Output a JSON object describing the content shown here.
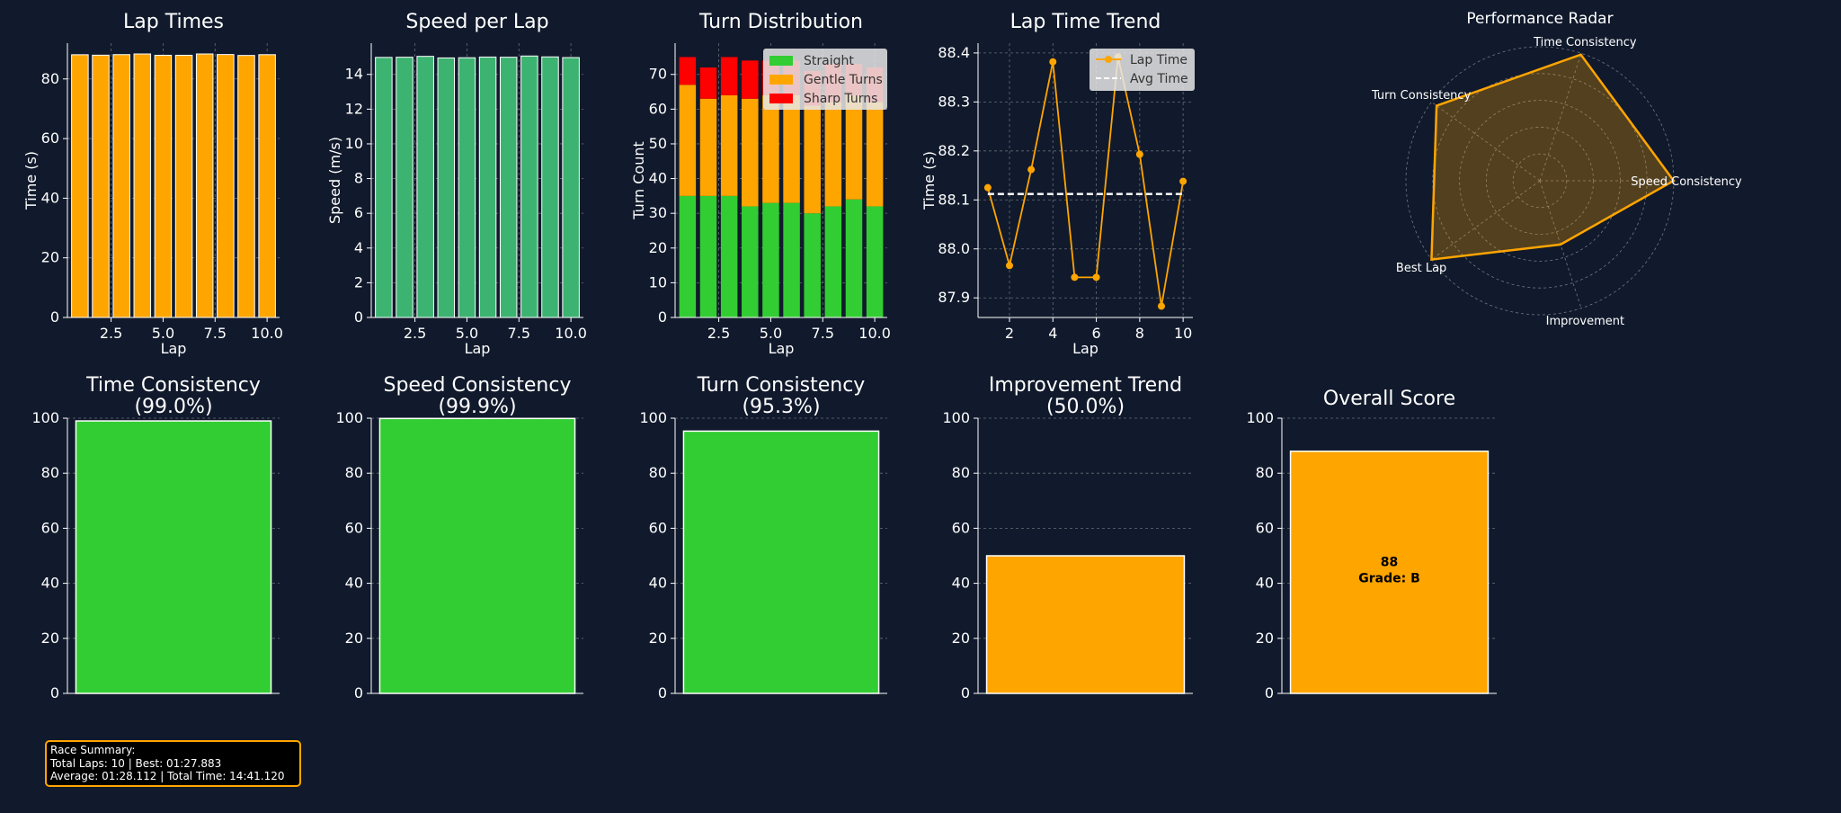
{
  "chart_data": [
    {
      "type": "bar",
      "title": "Lap Times",
      "xlabel": "Lap",
      "ylabel": "Time (s)",
      "x": [
        1,
        2,
        3,
        4,
        5,
        6,
        7,
        8,
        9,
        10
      ],
      "values": [
        88.12,
        87.97,
        88.16,
        88.38,
        87.94,
        87.94,
        88.38,
        88.19,
        87.88,
        88.14
      ],
      "xlim": [
        0.4,
        10.6
      ],
      "ylim": [
        0,
        92
      ],
      "xticks": [
        2.5,
        5.0,
        7.5,
        10.0
      ],
      "yticks": [
        0,
        20,
        40,
        60,
        80
      ],
      "grid": true,
      "colors": {
        "bar": "#ffa500",
        "edge": "#ffffff"
      }
    },
    {
      "type": "bar",
      "title": "Speed per Lap",
      "xlabel": "Lap",
      "ylabel": "Speed (m/s)",
      "x": [
        1,
        2,
        3,
        4,
        5,
        6,
        7,
        8,
        9,
        10
      ],
      "values": [
        14.98,
        14.99,
        15.04,
        14.95,
        14.96,
        15.0,
        14.99,
        15.06,
        15.01,
        14.97
      ],
      "xlim": [
        0.4,
        10.6
      ],
      "ylim": [
        0,
        15.8
      ],
      "xticks": [
        2.5,
        5.0,
        7.5,
        10.0
      ],
      "yticks": [
        0,
        2,
        4,
        6,
        8,
        10,
        12,
        14
      ],
      "grid": true,
      "colors": {
        "bar": "#3cb371",
        "edge": "#ffffff"
      }
    },
    {
      "type": "bar",
      "stacked": true,
      "title": "Turn Distribution",
      "xlabel": "Lap",
      "ylabel": "Turn Count",
      "x": [
        1,
        2,
        3,
        4,
        5,
        6,
        7,
        8,
        9,
        10
      ],
      "series": [
        {
          "name": "Straight",
          "values": [
            35,
            35,
            35,
            32,
            33,
            33,
            30,
            32,
            34,
            32
          ],
          "color": "#32cd32"
        },
        {
          "name": "Gentle Turns",
          "values": [
            32,
            28,
            29,
            31,
            31,
            31,
            31,
            30,
            30,
            30
          ],
          "color": "#ffa500"
        },
        {
          "name": "Sharp Turns",
          "values": [
            8,
            9,
            11,
            11,
            10,
            10,
            10,
            11,
            9,
            10
          ],
          "color": "#ff0000"
        }
      ],
      "xlim": [
        0.4,
        10.6
      ],
      "ylim": [
        0,
        79
      ],
      "xticks": [
        2.5,
        5.0,
        7.5,
        10.0
      ],
      "yticks": [
        0,
        10,
        20,
        30,
        40,
        50,
        60,
        70
      ],
      "grid": true,
      "legend": "top-right"
    },
    {
      "type": "line",
      "title": "Lap Time Trend",
      "xlabel": "Lap",
      "ylabel": "Time (s)",
      "x": [
        1,
        2,
        3,
        4,
        5,
        6,
        7,
        8,
        9,
        10
      ],
      "series": [
        {
          "name": "Lap Time",
          "values": [
            88.125,
            87.966,
            88.162,
            88.382,
            87.942,
            87.942,
            88.392,
            88.193,
            87.883,
            88.138
          ],
          "color": "#ffa500"
        },
        {
          "name": "Avg Time",
          "values": [
            88.112,
            88.112,
            88.112,
            88.112,
            88.112,
            88.112,
            88.112,
            88.112,
            88.112,
            88.112
          ],
          "color": "#ffffff",
          "dashed": true
        }
      ],
      "xlim": [
        0.55,
        10.45
      ],
      "ylim": [
        87.86,
        88.42
      ],
      "xticks": [
        2,
        4,
        6,
        8,
        10
      ],
      "yticks": [
        87.9,
        88.0,
        88.1,
        88.2,
        88.3,
        88.4
      ],
      "grid": true,
      "legend": "top-right"
    },
    {
      "type": "radar",
      "title": "Performance Radar",
      "axes": [
        "Speed Consistency",
        "Time Consistency",
        "Turn Consistency",
        "Best Lap",
        "Improvement"
      ],
      "values": [
        99.9,
        99.0,
        95.3,
        100,
        50.0
      ],
      "rmax": 100,
      "rings": [
        20,
        40,
        60,
        80,
        100
      ],
      "colors": {
        "line": "#ffa500",
        "fill": "#ffa500"
      }
    },
    {
      "type": "bar",
      "title": "Time Consistency",
      "subtitle": "(99.0%)",
      "values": [
        99.0
      ],
      "ylim": [
        0,
        100
      ],
      "yticks": [
        0,
        20,
        40,
        60,
        80,
        100
      ],
      "grid": true,
      "colors": {
        "bar": "#32cd32",
        "edge": "#ffffff"
      }
    },
    {
      "type": "bar",
      "title": "Speed Consistency",
      "subtitle": "(99.9%)",
      "values": [
        99.9
      ],
      "ylim": [
        0,
        100
      ],
      "yticks": [
        0,
        20,
        40,
        60,
        80,
        100
      ],
      "grid": true,
      "colors": {
        "bar": "#32cd32",
        "edge": "#ffffff"
      }
    },
    {
      "type": "bar",
      "title": "Turn Consistency",
      "subtitle": "(95.3%)",
      "values": [
        95.3
      ],
      "ylim": [
        0,
        100
      ],
      "yticks": [
        0,
        20,
        40,
        60,
        80,
        100
      ],
      "grid": true,
      "colors": {
        "bar": "#32cd32",
        "edge": "#ffffff"
      }
    },
    {
      "type": "bar",
      "title": "Improvement Trend",
      "subtitle": "(50.0%)",
      "values": [
        50.0
      ],
      "ylim": [
        0,
        100
      ],
      "yticks": [
        0,
        20,
        40,
        60,
        80,
        100
      ],
      "grid": true,
      "colors": {
        "bar": "#ffa500",
        "edge": "#ffffff"
      }
    },
    {
      "type": "bar",
      "title": "Overall Score",
      "subtitle": "",
      "values": [
        88
      ],
      "bar_label": [
        "88",
        "Grade: B"
      ],
      "ylim": [
        0,
        100
      ],
      "yticks": [
        0,
        20,
        40,
        60,
        80,
        100
      ],
      "grid": true,
      "colors": {
        "bar": "#ffa500",
        "edge": "#ffffff"
      }
    }
  ],
  "summary": {
    "line1": "Race Summary:",
    "line2": "Total Laps: 10 | Best: 01:27.883",
    "line3": "Average: 01:28.112 | Total Time: 14:41.120"
  },
  "theme": {
    "background": "#111a2c",
    "text": "#ffffff",
    "grid": "#8a8f98"
  }
}
